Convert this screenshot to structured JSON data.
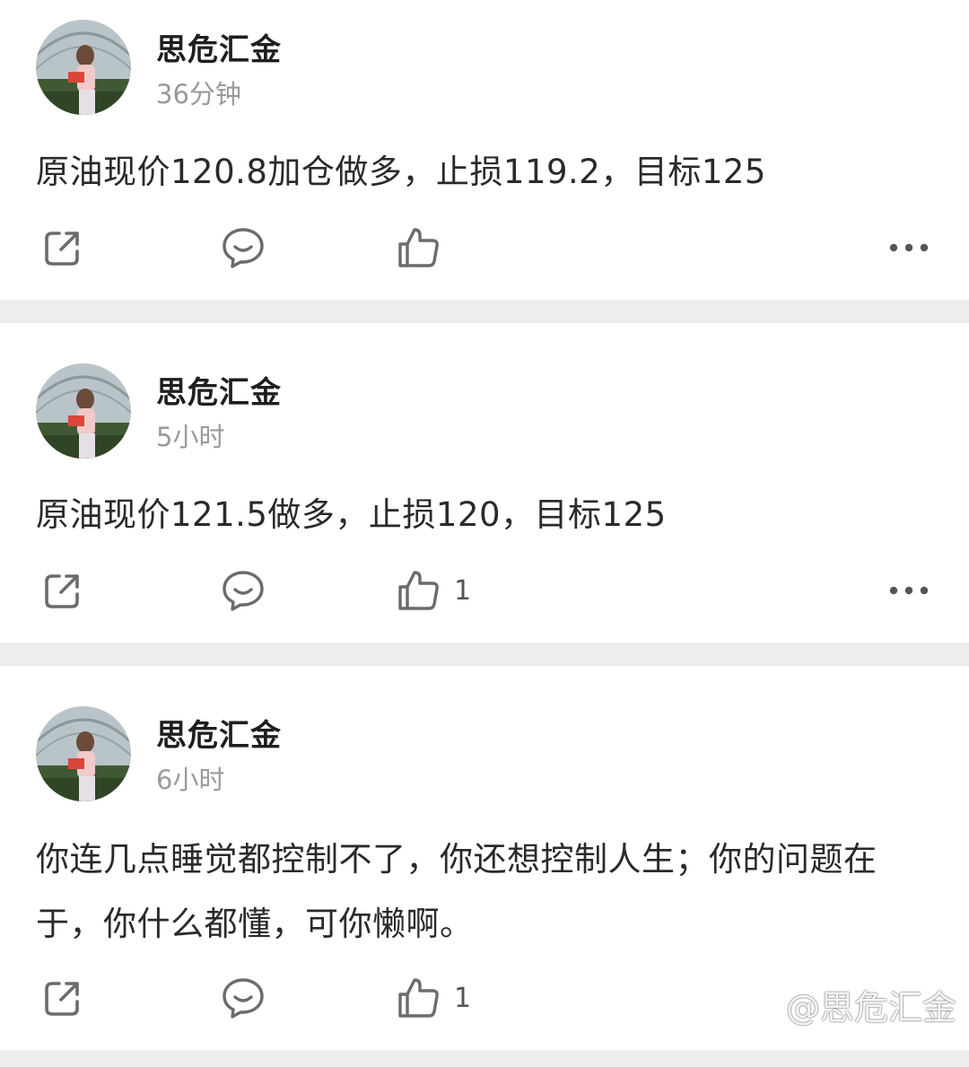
{
  "colors": {
    "page_bg": "#ededed",
    "card_bg": "#ffffff",
    "icon": "#6b6b6b",
    "time": "#9a9a9a"
  },
  "posts": [
    {
      "author": "思危汇金",
      "time": "36分钟",
      "content": "原油现价120.8加仓做多，止损119.2，目标125",
      "likes": ""
    },
    {
      "author": "思危汇金",
      "time": "5小时",
      "content": "原油现价121.5做多，止损120，目标125",
      "likes": "1"
    },
    {
      "author": "思危汇金",
      "time": "6小时",
      "content": "你连几点睡觉都控制不了，你还想控制人生；你的问题在于，你什么都懂，可你懒啊。",
      "likes": "1"
    }
  ],
  "icons": {
    "share": "share-icon",
    "comment": "comment-icon",
    "like": "thumbs-up-icon",
    "more": "more-icon"
  },
  "watermark": "@思危汇金"
}
